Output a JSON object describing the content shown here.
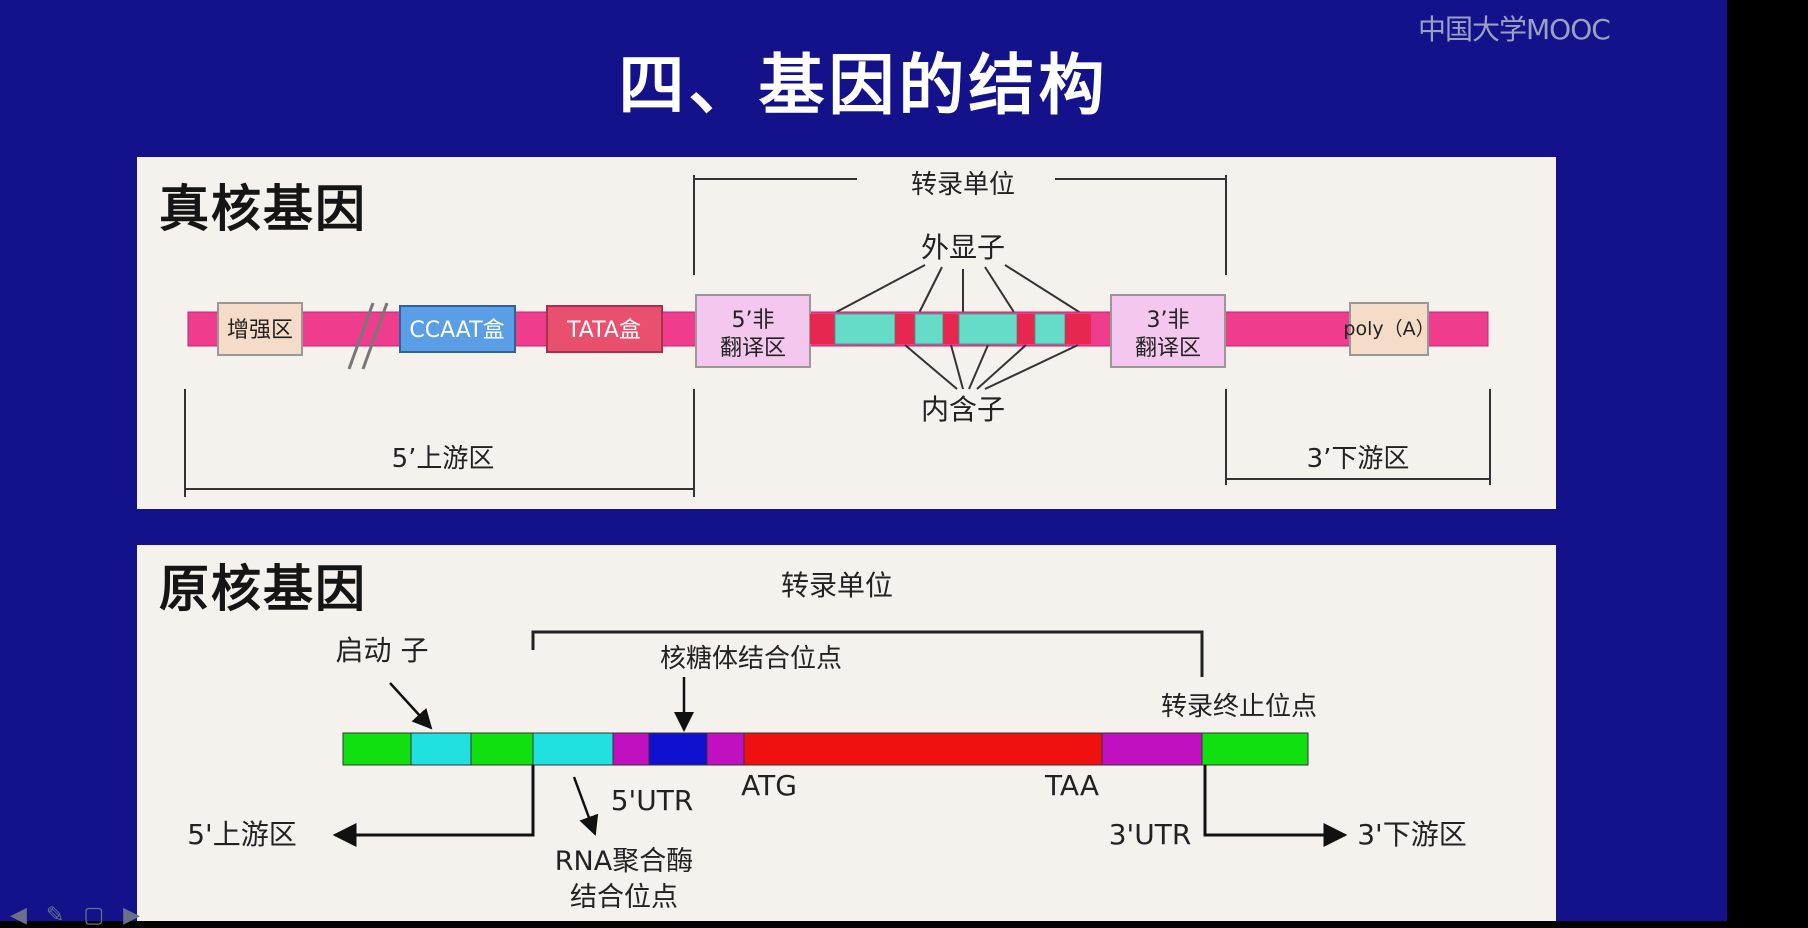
{
  "slide": {
    "title": "四、基因的结构",
    "watermark": "中国大学MOOC"
  },
  "eukaryote": {
    "panel_title": "真核基因",
    "transcription_unit": "转录单位",
    "exon_label": "外显子",
    "intron_label": "内含子",
    "enhancer": "增强区",
    "ccaat": "CCAAT盒",
    "tata": "TATA盒",
    "utr5": [
      "5’非",
      "翻译区"
    ],
    "utr3": [
      "3’非",
      "翻译区"
    ],
    "polya": "poly（A）",
    "upstream": "5’上游区",
    "downstream": "3’下游区",
    "colors": {
      "strand": "#f03c8c",
      "enhancer": "#f5dcc8",
      "ccaat": "#5a9ee6",
      "tata": "#e8506e",
      "utr": "#f4c8ee",
      "exon": "#64dcc8",
      "intron": "#e62850"
    }
  },
  "prokaryote": {
    "panel_title": "原核基因",
    "transcription_unit": "转录单位",
    "promoter": "启动 子",
    "ribosome_site": "核糖体结合位点",
    "termination_site": "转录终止位点",
    "utr5": "5'UTR",
    "atg": "ATG",
    "taa": "TAA",
    "utr3": "3'UTR",
    "upstream": "5'上游区",
    "downstream": "3'下游区",
    "rna_pol_site": [
      "RNA聚合酶",
      "结合位点"
    ],
    "colors": {
      "green": "#10e010",
      "cyan": "#20e0e0",
      "magenta": "#c010c0",
      "blue": "#1010d0",
      "red": "#f01010"
    }
  }
}
